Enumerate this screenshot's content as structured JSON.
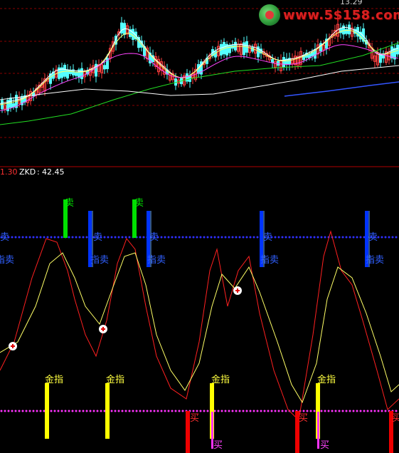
{
  "watermark": {
    "text": "www.5$158.com",
    "price_label": "13.29"
  },
  "indicator": {
    "value_prefix": "1.30",
    "name": "ZKD",
    "value": "42.45"
  },
  "signals": {
    "sell_green": "卖",
    "sell_blue_top": "卖",
    "sell_blue_bottom": "指卖",
    "buy_gold": "金指",
    "buy_red": "买",
    "buy_magenta": "买"
  },
  "colors": {
    "background": "#000000",
    "candle_up": "#ff4040",
    "candle_down": "#54ffff",
    "ma_white": "#ffffff",
    "ma_yellow": "#ffff66",
    "ma_magenta": "#ff44ff",
    "ma_green": "#22dd22",
    "ma_blue": "#3355ff",
    "grid": "#8a0000",
    "signal_green": "#00e000",
    "signal_blue": "#0033ff",
    "signal_yellow": "#ffff00",
    "signal_red": "#ee0000",
    "dots_blue": "#3030ff",
    "dots_magenta": "#ff33ff"
  }
}
